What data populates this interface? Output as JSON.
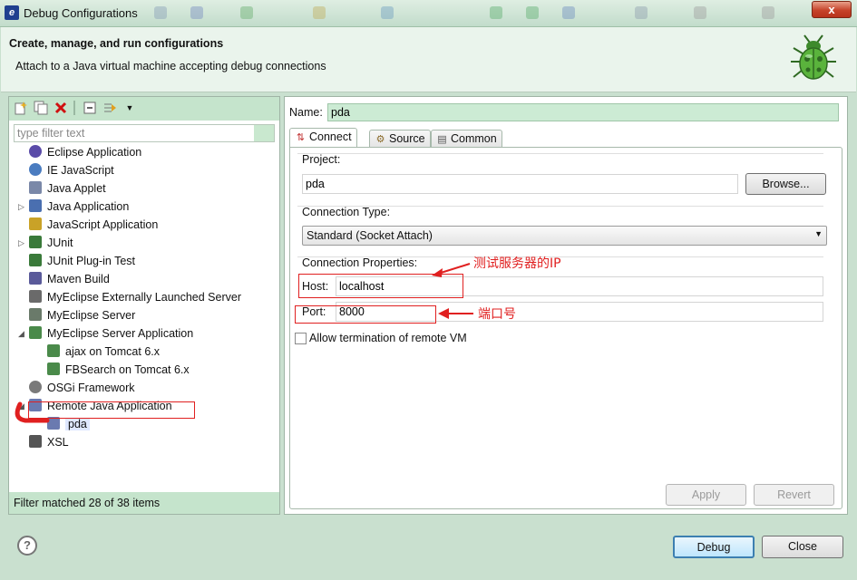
{
  "window": {
    "title": "Debug Configurations",
    "close_glyph": "x"
  },
  "header": {
    "title": "Create, manage, and run configurations",
    "subtitle": "Attach to a Java virtual machine accepting debug connections",
    "icon": "bug-icon"
  },
  "left": {
    "filter_placeholder": "type filter text",
    "status": "Filter matched 28 of 38 items",
    "tree": [
      {
        "label": "Eclipse Application",
        "icon": "eclipse-icon",
        "color": "#5a4ba8"
      },
      {
        "label": "IE JavaScript",
        "icon": "globe-icon",
        "color": "#4a7cc0"
      },
      {
        "label": "Java Applet",
        "icon": "applet-icon",
        "color": "#7a88a8"
      },
      {
        "label": "Java Application",
        "icon": "java-app-icon",
        "color": "#4a6fb0"
      },
      {
        "label": "JavaScript Application",
        "icon": "js-icon",
        "color": "#c9a227"
      },
      {
        "label": "JUnit",
        "icon": "junit-icon",
        "color": "#3a7a3a"
      },
      {
        "label": "JUnit Plug-in Test",
        "icon": "junit-plugin-icon",
        "color": "#3a7a3a"
      },
      {
        "label": "Maven Build",
        "icon": "maven-icon",
        "color": "#5a5a9a"
      },
      {
        "label": "MyEclipse Externally Launched Server",
        "icon": "server-icon",
        "color": "#6a6a6a"
      },
      {
        "label": "MyEclipse Server",
        "icon": "server-icon",
        "color": "#6a7a6a"
      },
      {
        "label": "MyEclipse Server Application",
        "icon": "server-app-icon",
        "color": "#4a8a4a"
      },
      {
        "label": "ajax on Tomcat  6.x",
        "icon": "tomcat-icon",
        "color": "#4a8a4a"
      },
      {
        "label": "FBSearch on Tomcat  6.x",
        "icon": "tomcat-icon",
        "color": "#4a8a4a"
      },
      {
        "label": "OSGi Framework",
        "icon": "osgi-icon",
        "color": "#7a7a7a"
      },
      {
        "label": "Remote Java Application",
        "icon": "remote-java-icon",
        "color": "#6a7ab0"
      },
      {
        "label": "pda",
        "icon": "config-icon",
        "color": "#6a7ab0"
      },
      {
        "label": "XSL",
        "icon": "xsl-icon",
        "color": "#555555"
      }
    ]
  },
  "right": {
    "name_label": "Name:",
    "name_value": "pda",
    "tabs": [
      {
        "label": "Connect",
        "icon": "connect-icon"
      },
      {
        "label": "Source",
        "icon": "source-icon"
      },
      {
        "label": "Common",
        "icon": "common-icon"
      }
    ],
    "project_label": "Project:",
    "project_value": "pda",
    "browse_label": "Browse...",
    "conn_type_label": "Connection Type:",
    "conn_type_value": "Standard (Socket Attach)",
    "conn_props_label": "Connection Properties:",
    "host_label": "Host:",
    "host_value": "localhost",
    "port_label": "Port:",
    "port_value": "8000",
    "allow_label": "Allow termination of remote VM",
    "apply_label": "Apply",
    "revert_label": "Revert"
  },
  "footer": {
    "debug_label": "Debug",
    "close_label": "Close",
    "help_glyph": "?"
  },
  "annotations": {
    "host_note": "测试服务器的IP",
    "port_note": "端口号",
    "color": "#e02020"
  }
}
